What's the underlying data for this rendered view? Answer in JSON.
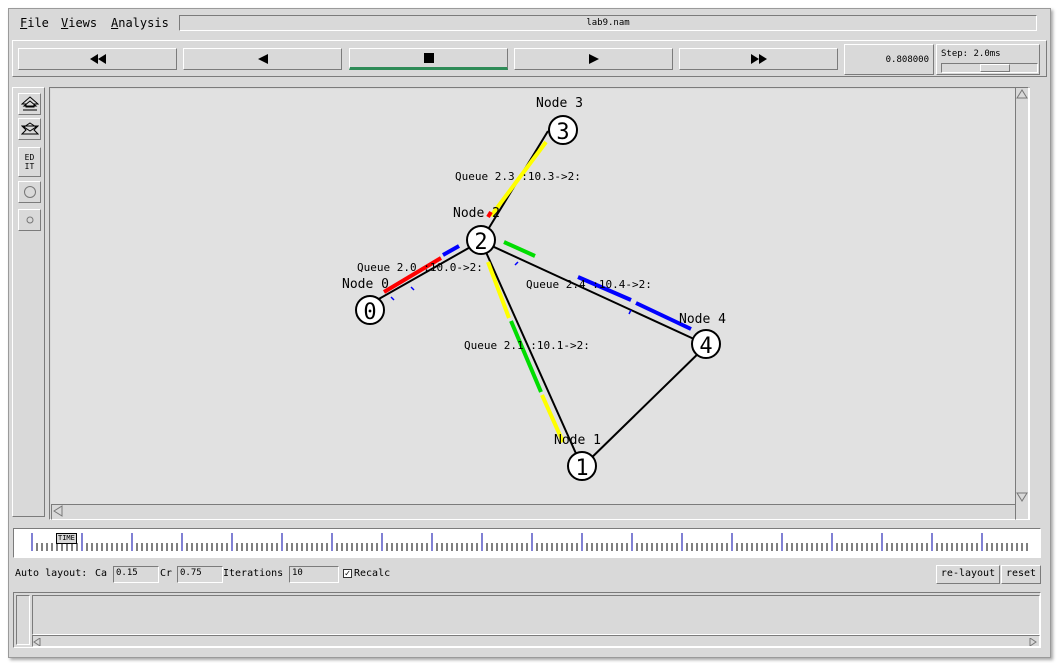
{
  "menu": {
    "file": "File",
    "views": "Views",
    "analysis": "Analysis"
  },
  "window": {
    "title": "lab9.nam"
  },
  "toolbar": {
    "rewind_icon": "fast-rewind-icon",
    "back_icon": "play-backward-icon",
    "stop_icon": "stop-icon",
    "play_icon": "play-forward-icon",
    "forward_icon": "fast-forward-icon",
    "active_button": "stop",
    "time": "0.808000",
    "step_label": "Step: 2.0ms"
  },
  "sidebar": {
    "zoom_in_icon": "zoom-in-icon",
    "zoom_out_icon": "zoom-out-icon",
    "edit_label": "ED\nIT",
    "circle_icon": "circle-icon",
    "small_circle_icon": "small-circle-icon"
  },
  "network": {
    "nodes": [
      {
        "id": "0",
        "label": "Node 0"
      },
      {
        "id": "1",
        "label": "Node 1"
      },
      {
        "id": "2",
        "label": "Node 2"
      },
      {
        "id": "3",
        "label": "Node 3"
      },
      {
        "id": "4",
        "label": "Node 4"
      }
    ],
    "queues": [
      {
        "label": "Queue 2.3 :10.3->2:"
      },
      {
        "label": "Queue 2.0 :10.0->2:"
      },
      {
        "label": "Queue 2.4 :10.4->2:"
      },
      {
        "label": "Queue 2.1 :10.1->2:"
      }
    ],
    "colors": {
      "red": "#ff0000",
      "blue": "#0000ff",
      "green": "#00dd00",
      "yellow": "#ffff00"
    }
  },
  "timeline": {
    "marker": "TIME"
  },
  "auto_layout": {
    "label": "Auto layout:",
    "ca_label": "Ca",
    "ca_value": "0.15",
    "cr_label": "Cr",
    "cr_value": "0.75",
    "iterations_label": "Iterations",
    "iterations_value": "10",
    "recalc_label": "Recalc",
    "recalc_checked": true,
    "relayout_label": "re-layout",
    "reset_label": "reset"
  }
}
